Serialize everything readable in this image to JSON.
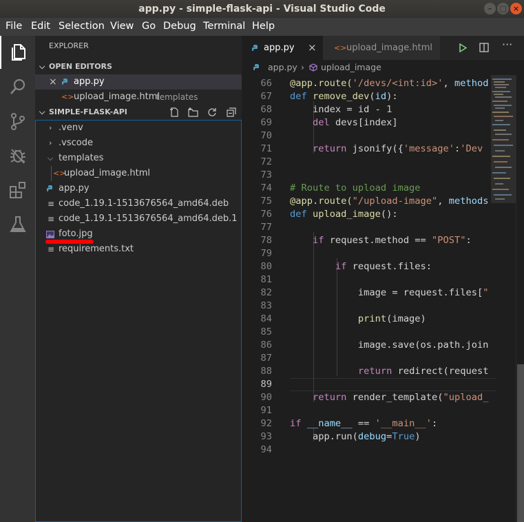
{
  "window": {
    "title": "app.py - simple-flask-api - Visual Studio Code",
    "controls": [
      "minimize",
      "maximize",
      "close"
    ]
  },
  "menu": [
    "File",
    "Edit",
    "Selection",
    "View",
    "Go",
    "Debug",
    "Terminal",
    "Help"
  ],
  "activity_bar": [
    "explorer-icon",
    "search-icon",
    "source-control-icon",
    "debug-icon",
    "extensions-icon",
    "test-flask-icon"
  ],
  "sidebar": {
    "title": "EXPLORER",
    "open_editors": {
      "header": "OPEN EDITORS",
      "items": [
        {
          "name": "app.py",
          "desc": "",
          "active": true
        },
        {
          "name": "upload_image.html",
          "desc": "templates"
        }
      ]
    },
    "project": {
      "header": "SIMPLE-FLASK-API",
      "tree": [
        {
          "name": ".venv",
          "type": "folder"
        },
        {
          "name": ".vscode",
          "type": "folder"
        },
        {
          "name": "templates",
          "type": "folder-open"
        },
        {
          "name": "upload_image.html",
          "type": "html"
        },
        {
          "name": "app.py",
          "type": "python"
        },
        {
          "name": "code_1.19.1-1513676564_amd64.deb",
          "type": "file"
        },
        {
          "name": "code_1.19.1-1513676564_amd64.deb.1",
          "type": "file"
        },
        {
          "name": "foto.jpg",
          "type": "image"
        },
        {
          "name": "requirements.txt",
          "type": "file"
        }
      ]
    }
  },
  "tabs": [
    {
      "label": "app.py",
      "active": true
    },
    {
      "label": "upload_image.html",
      "active": false
    }
  ],
  "breadcrumb": [
    "app.py",
    "upload_image"
  ],
  "editor": {
    "lines": [
      {
        "n": "66",
        "segs": [
          [
            "@app.route(",
            "fn"
          ],
          [
            "'/devs/<int:id>'",
            "str"
          ],
          [
            ", ",
            "p"
          ],
          [
            "method",
            "var"
          ]
        ]
      },
      {
        "n": "67",
        "segs": [
          [
            "def ",
            "kw"
          ],
          [
            "remove_dev",
            "fn"
          ],
          [
            "(",
            "p"
          ],
          [
            "id",
            "var"
          ],
          [
            "):",
            "p"
          ]
        ]
      },
      {
        "n": "68",
        "segs": [
          [
            "    index = id - ",
            "p"
          ],
          [
            "1",
            "num"
          ]
        ]
      },
      {
        "n": "69",
        "segs": [
          [
            "    ",
            "p"
          ],
          [
            "del",
            "kw2"
          ],
          [
            " devs[index]",
            "p"
          ]
        ]
      },
      {
        "n": "70",
        "segs": []
      },
      {
        "n": "71",
        "segs": [
          [
            "    ",
            "p"
          ],
          [
            "return",
            "kw2"
          ],
          [
            " jsonify({",
            "p"
          ],
          [
            "'message'",
            "str"
          ],
          [
            ":",
            "p"
          ],
          [
            "'Dev",
            "str"
          ]
        ]
      },
      {
        "n": "72",
        "segs": []
      },
      {
        "n": "73",
        "segs": []
      },
      {
        "n": "74",
        "segs": [
          [
            "# Route to upload image",
            "cm"
          ]
        ]
      },
      {
        "n": "75",
        "segs": [
          [
            "@app.route(",
            "fn"
          ],
          [
            "\"/upload-image\"",
            "str"
          ],
          [
            ", ",
            "p"
          ],
          [
            "methods",
            "var"
          ]
        ]
      },
      {
        "n": "76",
        "segs": [
          [
            "def ",
            "kw"
          ],
          [
            "upload_image",
            "fn"
          ],
          [
            "():",
            "p"
          ]
        ]
      },
      {
        "n": "77",
        "segs": []
      },
      {
        "n": "78",
        "segs": [
          [
            "    ",
            "p"
          ],
          [
            "if",
            "kw2"
          ],
          [
            " request.method == ",
            "p"
          ],
          [
            "\"POST\"",
            "str"
          ],
          [
            ":",
            "p"
          ]
        ]
      },
      {
        "n": "79",
        "segs": []
      },
      {
        "n": "80",
        "segs": [
          [
            "        ",
            "p"
          ],
          [
            "if",
            "kw2"
          ],
          [
            " request.files:",
            "p"
          ]
        ]
      },
      {
        "n": "81",
        "segs": []
      },
      {
        "n": "82",
        "segs": [
          [
            "            image = request.files[",
            "p"
          ],
          [
            "\"",
            "str"
          ]
        ]
      },
      {
        "n": "83",
        "segs": []
      },
      {
        "n": "84",
        "segs": [
          [
            "            ",
            "p"
          ],
          [
            "print",
            "fn"
          ],
          [
            "(image)",
            "p"
          ]
        ]
      },
      {
        "n": "85",
        "segs": []
      },
      {
        "n": "86",
        "segs": [
          [
            "            image.save(os.path.join",
            "p"
          ]
        ]
      },
      {
        "n": "87",
        "segs": []
      },
      {
        "n": "88",
        "segs": [
          [
            "            ",
            "p"
          ],
          [
            "return",
            "kw2"
          ],
          [
            " redirect(request",
            "p"
          ]
        ]
      },
      {
        "n": "89",
        "segs": []
      },
      {
        "n": "90",
        "segs": [
          [
            "    ",
            "p"
          ],
          [
            "return",
            "kw2"
          ],
          [
            " render_template(",
            "p"
          ],
          [
            "\"upload_",
            "str"
          ]
        ]
      },
      {
        "n": "91",
        "segs": []
      },
      {
        "n": "92",
        "segs": [
          [
            "if",
            "kw2"
          ],
          [
            " ",
            "p"
          ],
          [
            "__name__",
            "var"
          ],
          [
            " == ",
            "p"
          ],
          [
            "'__main__'",
            "str"
          ],
          [
            ":",
            "p"
          ]
        ]
      },
      {
        "n": "93",
        "segs": [
          [
            "    app.run(",
            "p"
          ],
          [
            "debug",
            "var"
          ],
          [
            "=",
            "p"
          ],
          [
            "True",
            "kw"
          ],
          [
            ")",
            "p"
          ]
        ]
      },
      {
        "n": "94",
        "segs": []
      }
    ],
    "current_line": "89"
  },
  "colors": {
    "accent_annotation": "#ff0000",
    "active_line": "#2a2a2a",
    "keyword": "#569cd6",
    "control": "#c586c0",
    "string": "#ce9178",
    "comment": "#6a9955",
    "function": "#dcdcaa"
  }
}
